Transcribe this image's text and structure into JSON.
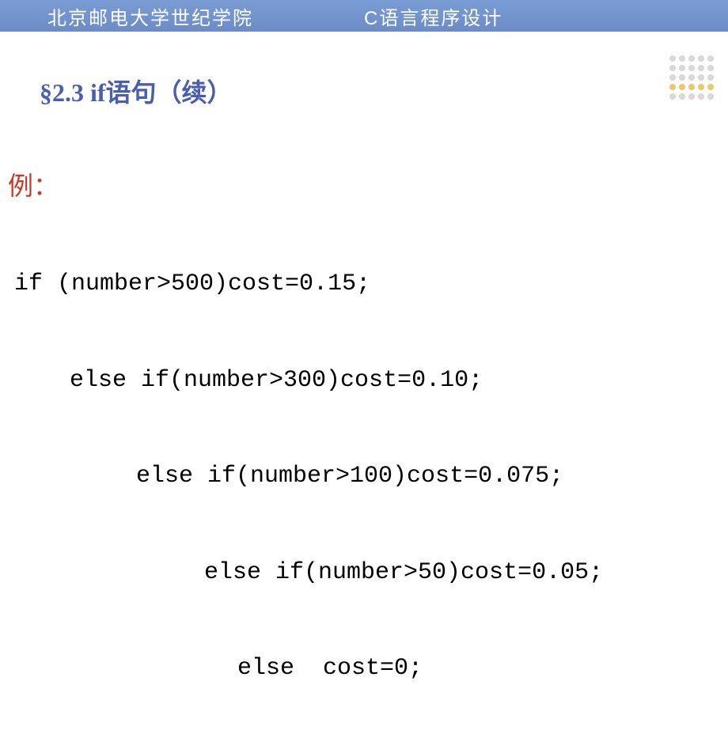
{
  "header": {
    "left": "北京邮电大学世纪学院",
    "right": "C语言程序设计"
  },
  "title": "§2.3 if语句（续）",
  "example_label": "例：",
  "code": {
    "line1": "if (number>500)cost=0.15;",
    "line2": "else if(number>300)cost=0.10;",
    "line3": "else if(number>100)cost=0.075;",
    "line4": "else if(number>50)cost=0.05;",
    "line5": "else  cost=0;"
  }
}
